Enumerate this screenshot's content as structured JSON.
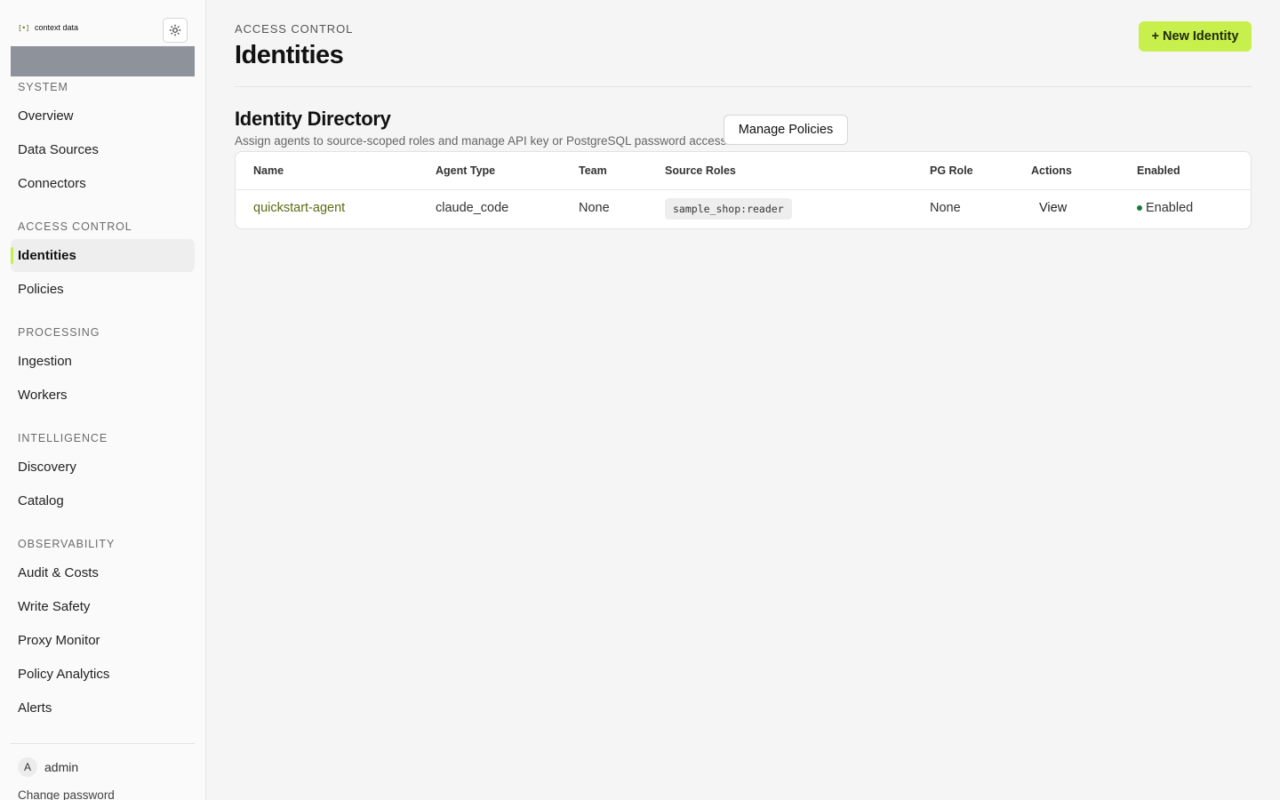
{
  "brand": {
    "mark": "[•]",
    "name": "context data"
  },
  "theme_toggle_icon": "sun-icon",
  "sidebar": {
    "sections": [
      {
        "title": "SYSTEM",
        "items": [
          "Overview",
          "Data Sources",
          "Connectors"
        ]
      },
      {
        "title": "ACCESS CONTROL",
        "items": [
          "Identities",
          "Policies"
        ]
      },
      {
        "title": "PROCESSING",
        "items": [
          "Ingestion",
          "Workers"
        ]
      },
      {
        "title": "INTELLIGENCE",
        "items": [
          "Discovery",
          "Catalog"
        ]
      },
      {
        "title": "OBSERVABILITY",
        "items": [
          "Audit & Costs",
          "Write Safety",
          "Proxy Monitor",
          "Policy Analytics",
          "Alerts"
        ]
      }
    ],
    "active_item": "Identities",
    "user": {
      "avatar_initial": "A",
      "name": "admin",
      "change_password": "Change password"
    }
  },
  "header": {
    "breadcrumb": "ACCESS CONTROL",
    "title": "Identities",
    "new_button": "+ New Identity"
  },
  "directory": {
    "title": "Identity Directory",
    "subtitle": "Assign agents to source-scoped roles and manage API key or PostgreSQL password access.",
    "manage_button": "Manage Policies",
    "columns": [
      "Name",
      "Agent Type",
      "Team",
      "Source Roles",
      "PG Role",
      "Actions",
      "Enabled"
    ],
    "rows": [
      {
        "name": "quickstart-agent",
        "agent_type": "claude_code",
        "team": "None",
        "source_roles": "sample_shop:reader",
        "pg_role": "None",
        "action": "View",
        "enabled": "Enabled"
      }
    ]
  },
  "colors": {
    "accent": "#c8f04c",
    "link": "#5a6b12",
    "enabled_dot": "#1b7a35"
  }
}
